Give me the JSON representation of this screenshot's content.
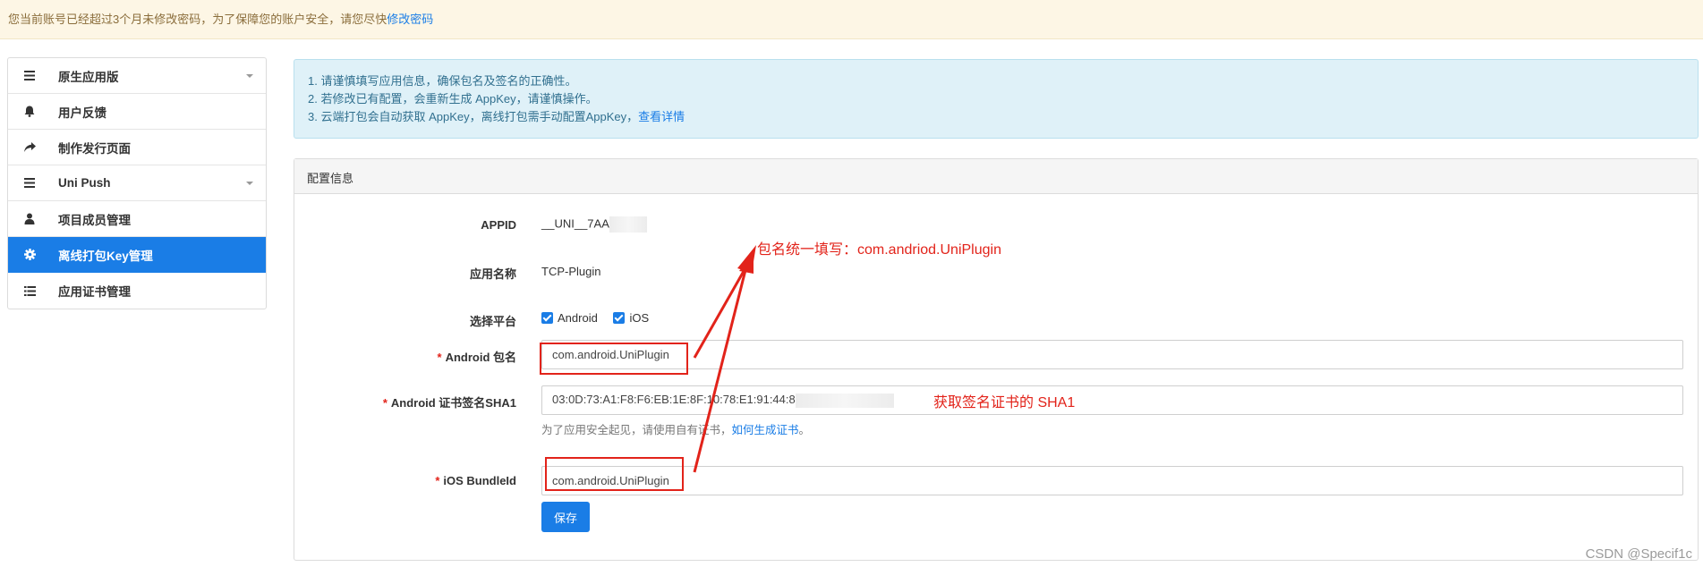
{
  "notice": {
    "text": "您当前账号已经超过3个月未修改密码，为了保障您的账户安全，请您尽快",
    "link": "修改密码"
  },
  "sidebar": {
    "items": [
      {
        "label": "原生应用版",
        "icon": "menu-icon",
        "has_caret": true
      },
      {
        "label": "用户反馈",
        "icon": "bell-icon"
      },
      {
        "label": "制作发行页面",
        "icon": "share-arrow-icon"
      },
      {
        "label": "Uni Push",
        "icon": "menu-icon",
        "has_caret": true
      },
      {
        "label": "项目成员管理",
        "icon": "user-icon"
      },
      {
        "label": "离线打包Key管理",
        "icon": "gear-icon",
        "active": true
      },
      {
        "label": "应用证书管理",
        "icon": "list-icon"
      }
    ]
  },
  "info": {
    "line1": "1. 请谨慎填写应用信息，确保包名及签名的正确性。",
    "line2": "2. 若修改已有配置，会重新生成 AppKey，请谨慎操作。",
    "line3": "3. 云端打包会自动获取 AppKey，离线打包需手动配置AppKey，",
    "line3_link": "查看详情"
  },
  "config": {
    "title": "配置信息",
    "appid_label": "APPID",
    "appid_value": "__UNI__7AA",
    "appname_label": "应用名称",
    "appname_value": "TCP-Plugin",
    "platform_label": "选择平台",
    "platform_android": "Android",
    "platform_ios": "iOS",
    "android_pkg_label": "Android 包名",
    "android_pkg_value": "com.android.UniPlugin",
    "sha1_label": "Android 证书签名SHA1",
    "sha1_value": "03:0D:73:A1:F8:F6:EB:1E:8F:10:78:E1:91:44:8",
    "sha1_hint": "为了应用安全起见，请使用自有证书，",
    "sha1_hint_link": "如何生成证书",
    "sha1_hint_end": "。",
    "ios_label": "iOS BundleId",
    "ios_value": "com.android.UniPlugin",
    "required_mark": "*",
    "save": "保存"
  },
  "annotations": {
    "pkg_note": "包名统一填写：com.andriod.UniPlugin",
    "sha1_note": "获取签名证书的 SHA1",
    "color": "#e2231a"
  },
  "watermark": "CSDN @Specif1c"
}
